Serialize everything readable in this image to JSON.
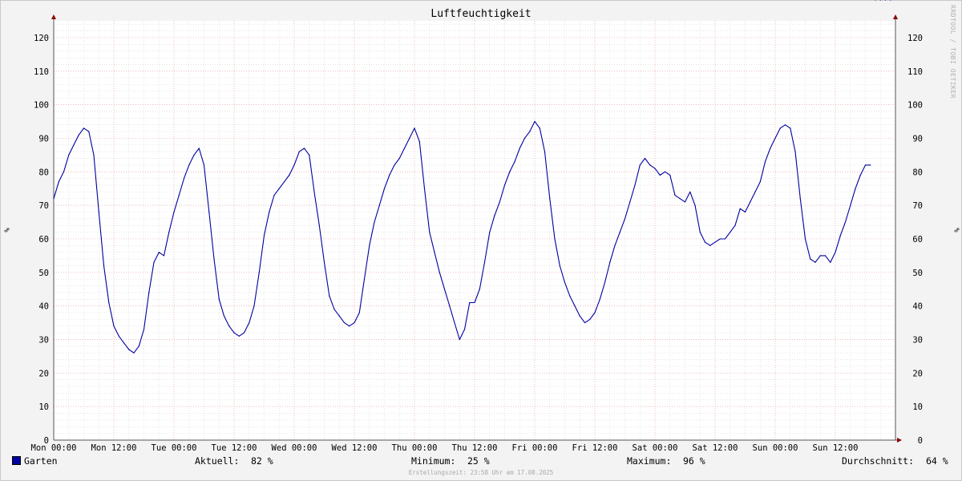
{
  "chart_data": {
    "type": "line",
    "title": "Luftfeuchtigkeit",
    "ylabel": "%",
    "ylabel_right": "%",
    "ylim": [
      0,
      125
    ],
    "yticks": [
      0,
      10,
      20,
      30,
      40,
      50,
      60,
      70,
      80,
      90,
      100,
      110,
      120
    ],
    "xticks": [
      "Mon 00:00",
      "Mon 12:00",
      "Tue 00:00",
      "Tue 12:00",
      "Wed 00:00",
      "Wed 12:00",
      "Thu 00:00",
      "Thu 12:00",
      "Fri 00:00",
      "Fri 12:00",
      "Sat 00:00",
      "Sat 12:00",
      "Sun 00:00",
      "Sun 12:00"
    ],
    "xlim_hours": [
      0,
      168
    ],
    "grid": true,
    "legend_position": "bottom-left",
    "series": [
      {
        "name": "Garten",
        "color": "#0000a0",
        "x_hours": [
          0,
          1,
          2,
          3,
          4,
          5,
          6,
          7,
          8,
          9,
          10,
          11,
          12,
          13,
          14,
          15,
          16,
          17,
          18,
          19,
          20,
          21,
          22,
          23,
          24,
          25,
          26,
          27,
          28,
          29,
          30,
          31,
          32,
          33,
          34,
          35,
          36,
          37,
          38,
          39,
          40,
          41,
          42,
          43,
          44,
          45,
          46,
          47,
          48,
          49,
          50,
          51,
          52,
          53,
          54,
          55,
          56,
          57,
          58,
          59,
          60,
          61,
          62,
          63,
          64,
          65,
          66,
          67,
          68,
          69,
          70,
          71,
          72,
          73,
          74,
          75,
          76,
          77,
          78,
          79,
          80,
          81,
          82,
          83,
          84,
          85,
          86,
          87,
          88,
          89,
          90,
          91,
          92,
          93,
          94,
          95,
          96,
          97,
          98,
          99,
          100,
          101,
          102,
          103,
          104,
          105,
          106,
          107,
          108,
          109,
          110,
          111,
          112,
          113,
          114,
          115,
          116,
          117,
          118,
          119,
          120,
          121,
          122,
          123,
          124,
          125,
          126,
          127,
          128,
          129,
          130,
          131,
          132,
          133,
          134,
          135,
          136,
          137,
          138,
          139,
          140,
          141,
          142,
          143,
          144,
          145,
          146,
          147,
          148,
          149,
          150,
          151,
          152,
          153,
          154,
          155,
          156,
          157,
          158,
          159,
          160,
          161,
          162,
          163,
          164,
          165,
          166,
          167
        ],
        "values": [
          72,
          77,
          80,
          85,
          88,
          91,
          93,
          92,
          85,
          68,
          52,
          41,
          34,
          31,
          29,
          27,
          26,
          28,
          33,
          44,
          53,
          56,
          55,
          62,
          68,
          73,
          78,
          82,
          85,
          87,
          82,
          68,
          54,
          42,
          37,
          34,
          32,
          31,
          32,
          35,
          40,
          50,
          61,
          68,
          73,
          75,
          77,
          79,
          82,
          86,
          87,
          85,
          74,
          64,
          53,
          43,
          39,
          37,
          35,
          34,
          35,
          38,
          48,
          58,
          65,
          70,
          75,
          79,
          82,
          84,
          87,
          90,
          93,
          89,
          75,
          62,
          56,
          50,
          45,
          40,
          35,
          30,
          33,
          41,
          41,
          45,
          53,
          62,
          67,
          71,
          76,
          80,
          83,
          87,
          90,
          92,
          95,
          93,
          86,
          72,
          60,
          52,
          47,
          43,
          40,
          37,
          35,
          36,
          38,
          42,
          47,
          53,
          58,
          62,
          66,
          71,
          76,
          82,
          84,
          82,
          81,
          79,
          80,
          79,
          73,
          72,
          71,
          74,
          70,
          62,
          59,
          58,
          59,
          60,
          60,
          62,
          64,
          69,
          68,
          71,
          74,
          77,
          83,
          87,
          90,
          93,
          94,
          93,
          86,
          72,
          60,
          54,
          53,
          55,
          55,
          53,
          56,
          61,
          65,
          70,
          75,
          79,
          82,
          82
        ],
        "aktuell": "82 %",
        "minimum": "25 %",
        "maximum": "96 %",
        "durchschnitt": "64 %"
      }
    ]
  },
  "legend": {
    "series_name": "Garten",
    "swatch_color": "#0000a0",
    "aktuell_label": "Aktuell:",
    "aktuell_value": "82 %",
    "minimum_label": "Minimum:",
    "minimum_value": "25 %",
    "maximum_label": "Maximum:",
    "maximum_value": "96 %",
    "durchschnitt_label": "Durchschnitt:",
    "durchschnitt_value": "64 %"
  },
  "footer": "Erstellungszeit: 23:58 Uhr am 17.08.2025",
  "watermark": "RRDTOOL / TOBI OETIKER",
  "colors": {
    "background": "#f3f3f3",
    "plot_background": "#ffffff",
    "major_grid": "#e8a0a0",
    "minor_grid": "#d8d8d8",
    "axis": "#555555",
    "arrow": "#8b0000"
  }
}
